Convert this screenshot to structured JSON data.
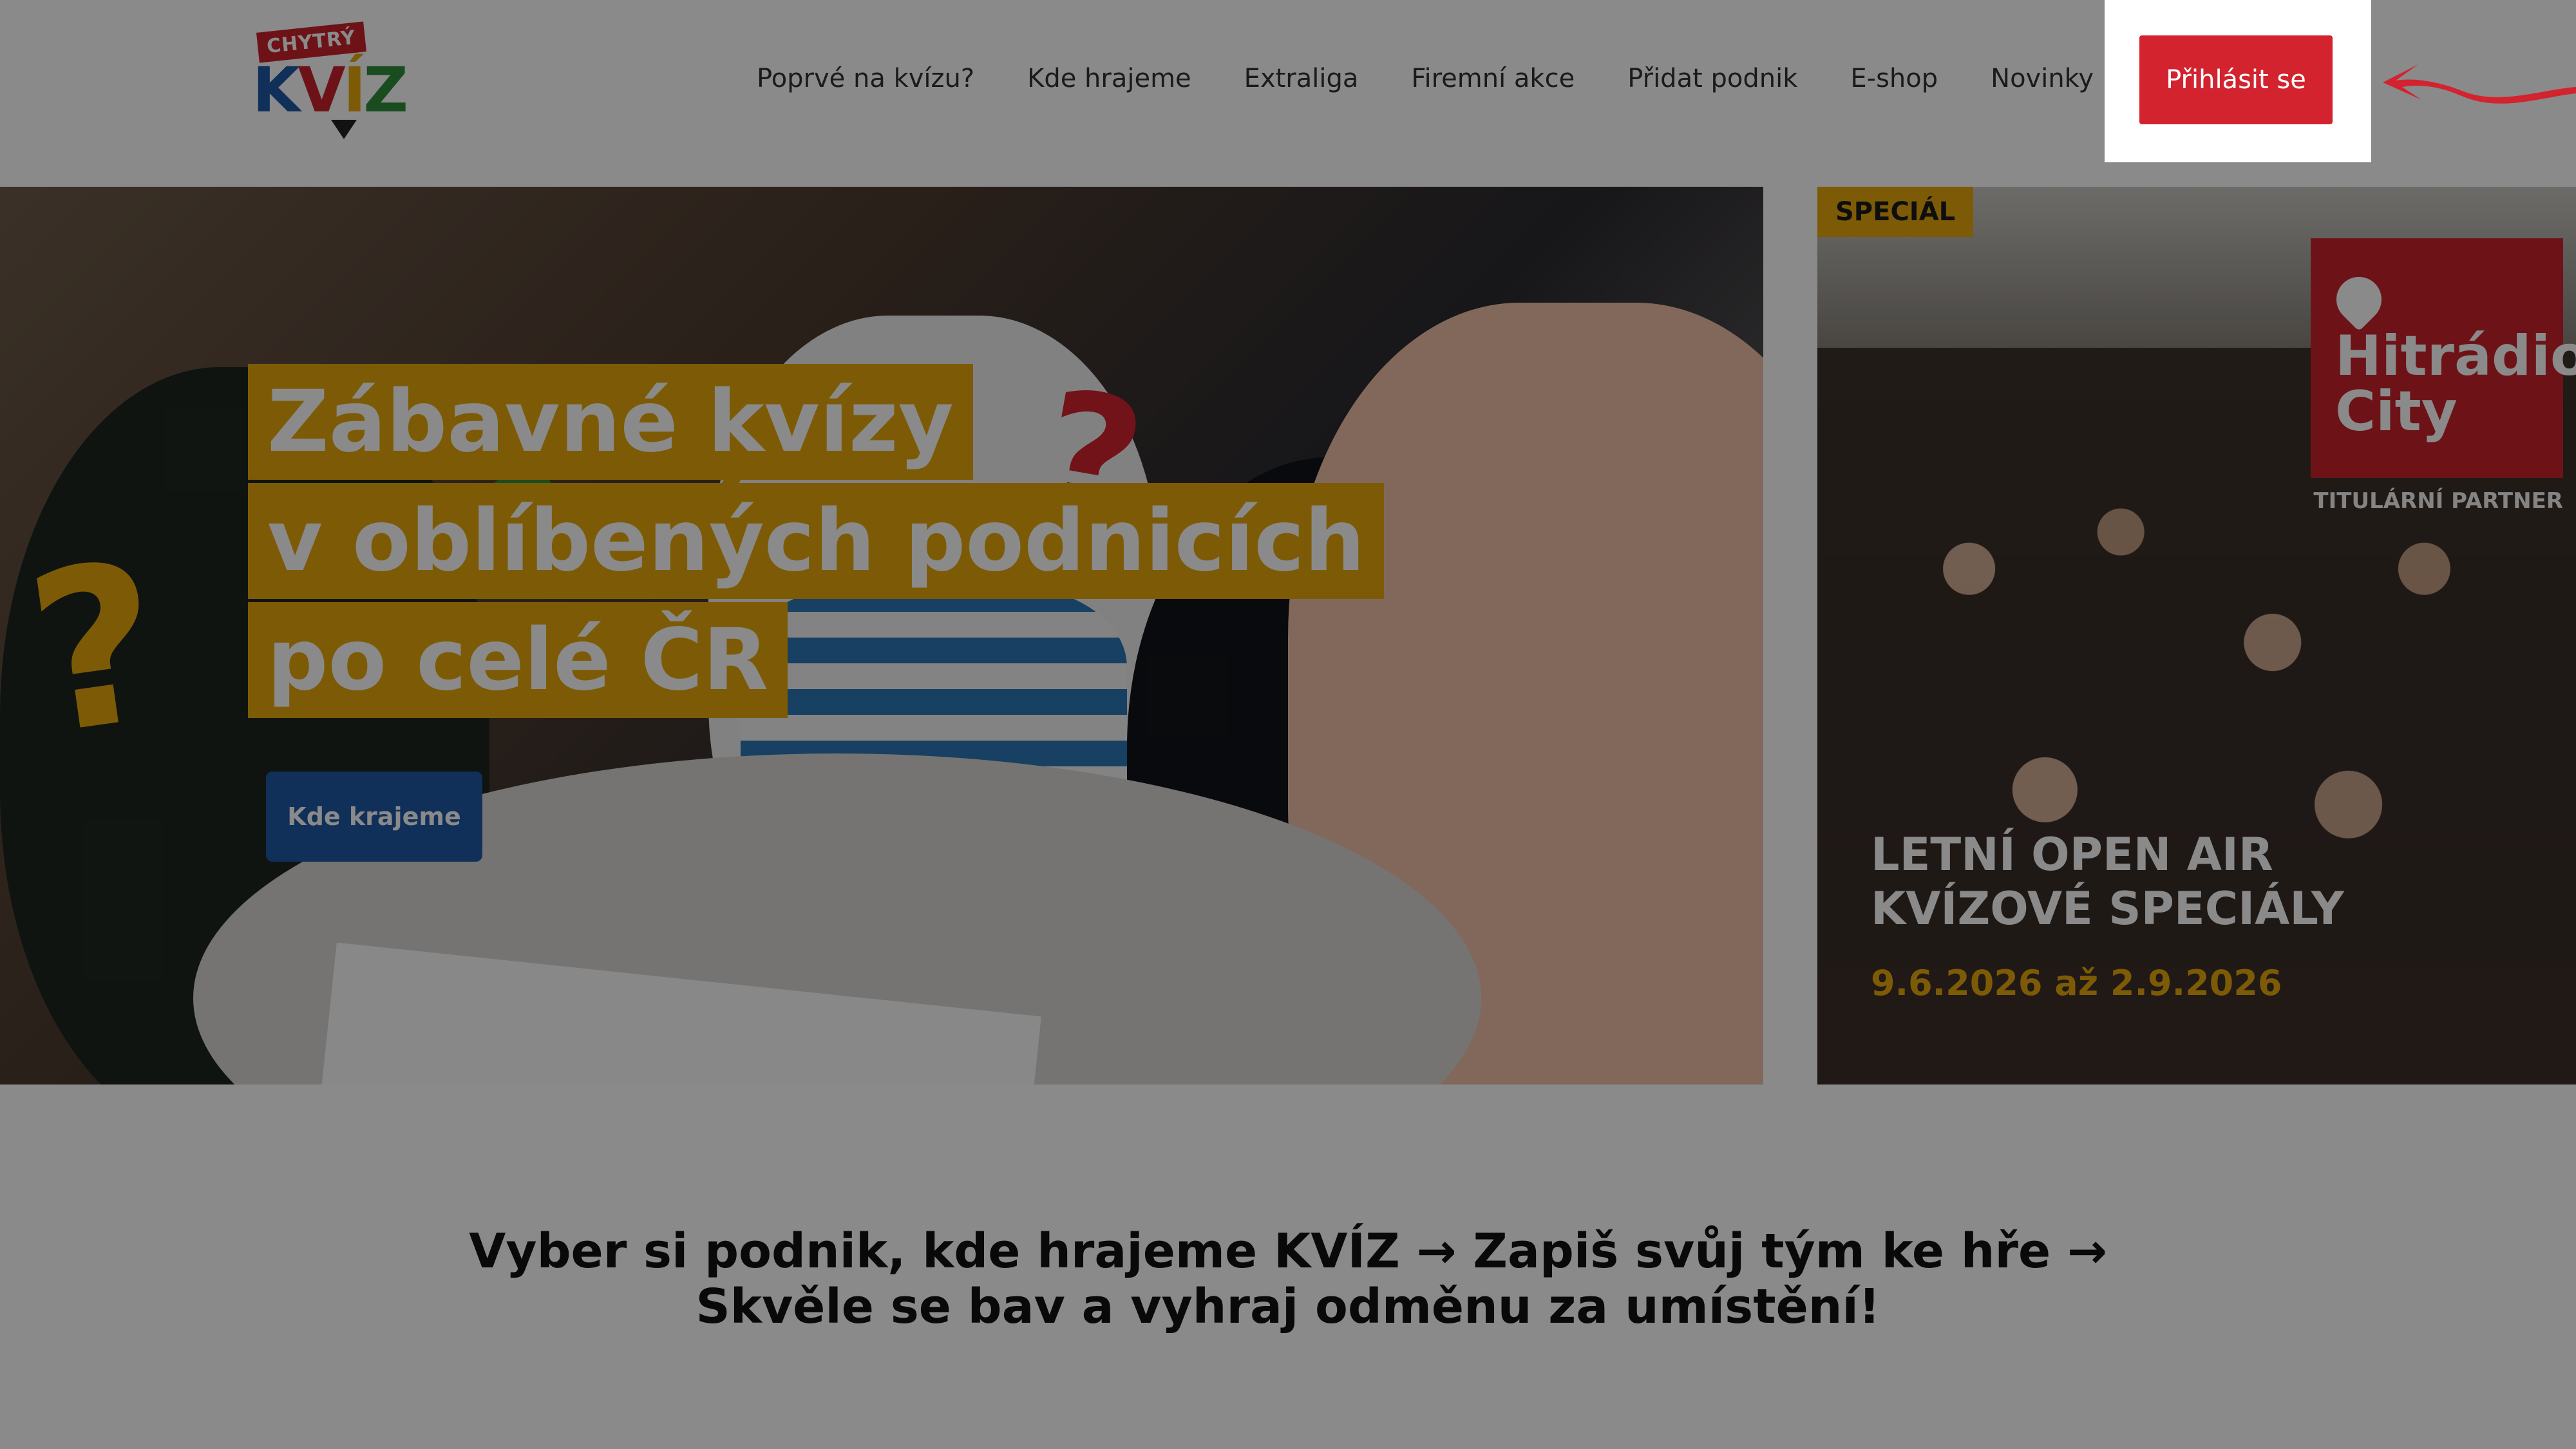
{
  "brand": {
    "logo_top": "CHYTRÝ",
    "logo_main_k": "K",
    "logo_main_v": "V",
    "logo_main_i": "Í",
    "logo_main_z": "Z",
    "colors": {
      "red": "#d2232f",
      "blue": "#1f5aa6",
      "yellow": "#e8a80c",
      "green": "#2f8f3a"
    }
  },
  "nav": {
    "items": [
      {
        "label": "Poprvé na kvízu?"
      },
      {
        "label": "Kde hrajeme"
      },
      {
        "label": "Extraliga"
      },
      {
        "label": "Firemní akce"
      },
      {
        "label": "Přidat podnik"
      },
      {
        "label": "E-shop"
      },
      {
        "label": "Novinky"
      }
    ],
    "login_label": "Přihlásit se"
  },
  "hero": {
    "headline_lines": [
      "Zábavné kvízy",
      "v oblíbených podnicích",
      "po celé ČR"
    ],
    "cta_label": "Kde krajeme"
  },
  "special": {
    "badge": "SPECIÁL",
    "partner_name_1": "Hitrádio",
    "partner_name_2": "City",
    "partner_label": "TITULÁRNÍ PARTNER",
    "title_1": "LETNÍ OPEN AIR",
    "title_2": "KVÍZOVÉ SPECIÁLY",
    "date": "9.6.2026 až 2.9.2026"
  },
  "tagline": {
    "line1": "Vyber si podnik, kde hrajeme KVÍZ → Zapiš svůj tým ke hře →",
    "line2": "Skvěle se bav a vyhraj odměnu za umístění!"
  }
}
